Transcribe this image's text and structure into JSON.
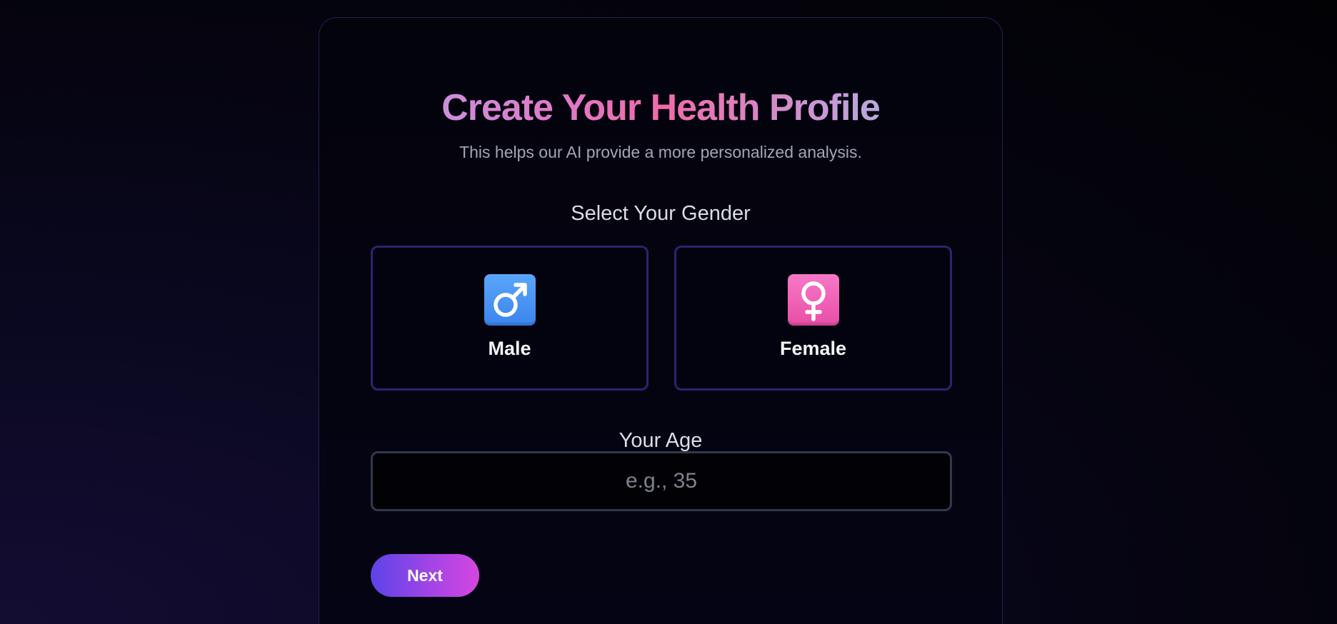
{
  "profile": {
    "title": "Create Your Health Profile",
    "subtitle": "This helps our AI provide a more personalized analysis."
  },
  "gender": {
    "label": "Select Your Gender",
    "options": [
      {
        "label": "Male",
        "icon": "male-sign-icon",
        "color": "#4a94f4"
      },
      {
        "label": "Female",
        "icon": "female-sign-icon",
        "color": "#f062b8"
      }
    ]
  },
  "age": {
    "label": "Your Age",
    "value": "",
    "placeholder": "e.g., 35"
  },
  "actions": {
    "next_label": "Next"
  },
  "colors": {
    "accent_start": "#5c44e8",
    "accent_end": "#d646e0",
    "card_border": "#2b2372"
  }
}
